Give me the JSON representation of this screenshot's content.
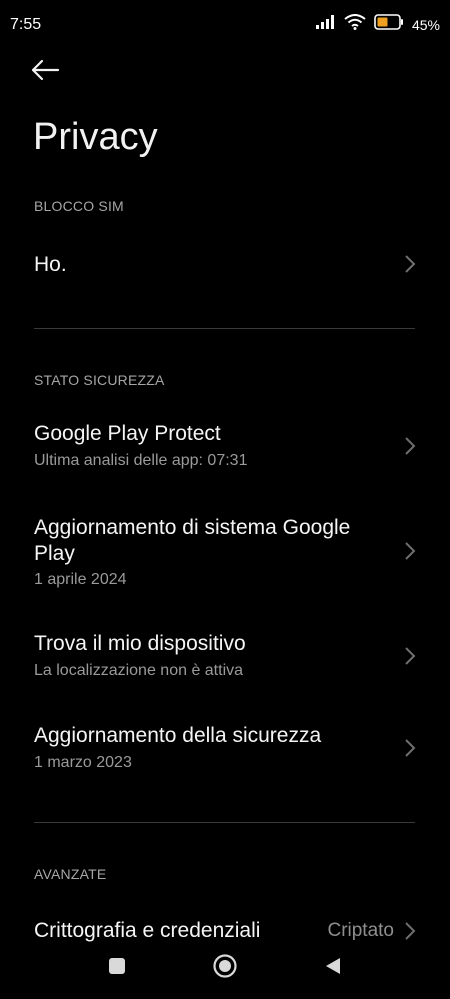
{
  "status_bar": {
    "time": "7:55",
    "battery_percent": "45%",
    "icons": [
      "signal-icon",
      "wifi-icon",
      "battery-icon"
    ]
  },
  "header": {
    "back_icon": "arrow-left-icon",
    "title": "Privacy"
  },
  "sections": {
    "sim_lock": {
      "header": "BLOCCO SIM",
      "items": [
        {
          "title": "Ho."
        }
      ]
    },
    "security_status": {
      "header": "STATO SICUREZZA",
      "items": [
        {
          "title": "Google Play Protect",
          "subtitle": "Ultima analisi delle app: 07:31"
        },
        {
          "title_line1": "Aggiornamento di sistema Google",
          "title_line2": "Play",
          "subtitle": "1 aprile 2024"
        },
        {
          "title": "Trova il mio dispositivo",
          "subtitle": "La localizzazione non è attiva"
        },
        {
          "title": "Aggiornamento della sicurezza",
          "subtitle": "1 marzo 2023"
        }
      ]
    },
    "advanced": {
      "header": "AVANZATE",
      "items": [
        {
          "title": "Crittografia e credenziali",
          "value": "Criptato"
        }
      ]
    }
  },
  "nav_bar": {
    "buttons": [
      "recents-square-icon",
      "home-circle-icon",
      "back-triangle-icon"
    ]
  },
  "colors": {
    "background": "#000000",
    "text_primary": "#f5f5f5",
    "text_secondary": "#9a9a9a",
    "battery_fill": "#f0a020"
  }
}
